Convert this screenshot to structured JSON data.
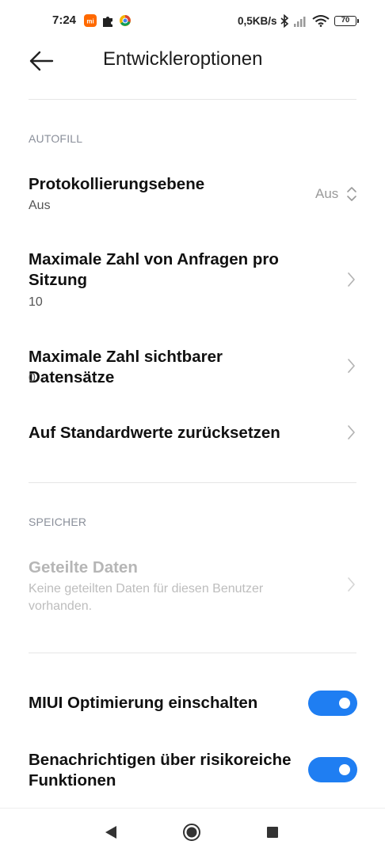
{
  "status_bar": {
    "time": "7:24",
    "network_speed": "0,5KB/s",
    "battery": "70"
  },
  "header": {
    "title": "Entwickleroptionen"
  },
  "sections": {
    "autofill": {
      "header": "AUTOFILL",
      "items": [
        {
          "title": "Protokollierungsebene",
          "subtitle": "Aus",
          "value": "Aus"
        },
        {
          "title": "Maximale Zahl von Anfragen pro Sitzung",
          "subtitle": "10"
        },
        {
          "title": "Maximale Zahl sichtbarer Datensätze",
          "subtitle": "0"
        },
        {
          "title": "Auf Standardwerte zurücksetzen"
        }
      ]
    },
    "storage": {
      "header": "SPEICHER",
      "items": [
        {
          "title": "Geteilte Daten",
          "subtitle": "Keine geteilten Daten für diesen Benutzer vorhanden.",
          "enabled": false
        }
      ]
    },
    "toggles": [
      {
        "title": "MIUI Optimierung einschalten",
        "checked": true
      },
      {
        "title": "Benachrichtigen über risikoreiche Funktionen",
        "checked": true
      }
    ]
  },
  "colors": {
    "accent": "#1f7ef2",
    "section_header": "#8a8f9a",
    "disabled_text": "#b6b6b6"
  },
  "icons": {
    "status": [
      "mi-app-icon",
      "puzzle-icon",
      "chrome-like-icon",
      "bluetooth-icon",
      "signal-icon",
      "wifi-icon",
      "battery-icon"
    ],
    "navigation": [
      "back-arrow-icon",
      "nav-back-icon",
      "nav-home-icon",
      "nav-recents-icon"
    ]
  }
}
